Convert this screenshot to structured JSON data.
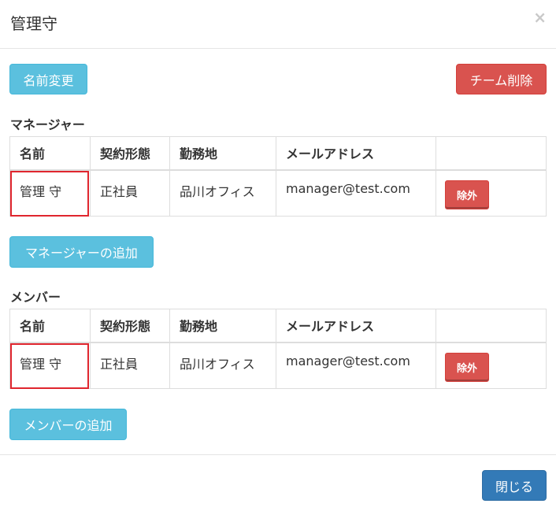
{
  "modal": {
    "title": "管理守",
    "close_label": "×"
  },
  "toolbar": {
    "rename_label": "名前変更",
    "delete_team_label": "チーム削除"
  },
  "managers": {
    "title": "マネージャー",
    "headers": [
      "名前",
      "契約形態",
      "勤務地",
      "メールアドレス",
      ""
    ],
    "rows": [
      {
        "name": "管理 守",
        "contract": "正社員",
        "location": "品川オフィス",
        "email": "manager@test.com",
        "remove_label": "除外"
      }
    ],
    "add_label": "マネージャーの追加"
  },
  "members": {
    "title": "メンバー",
    "headers": [
      "名前",
      "契約形態",
      "勤務地",
      "メールアドレス",
      ""
    ],
    "rows": [
      {
        "name": "管理 守",
        "contract": "正社員",
        "location": "品川オフィス",
        "email": "manager@test.com",
        "remove_label": "除外"
      }
    ],
    "add_label": "メンバーの追加"
  },
  "footer": {
    "close_label": "閉じる"
  },
  "colors": {
    "info": "#5bc0de",
    "danger": "#d9534f",
    "primary": "#337ab7",
    "highlight": "#e0262e"
  }
}
